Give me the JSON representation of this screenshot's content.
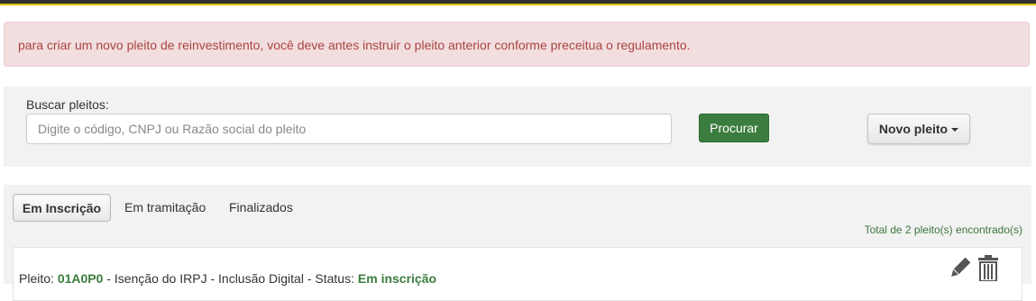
{
  "alert": {
    "message": "para criar um novo pleito de reinvestimento, você deve antes instruir o pleito anterior conforme preceitua o regulamento."
  },
  "search": {
    "label": "Buscar pleitos:",
    "placeholder": "Digite o código, CNPJ ou Razão social do pleito",
    "value": "",
    "button_label": "Procurar",
    "new_button_label": "Novo pleito",
    "colors": {
      "search_button": "#3b7d3e"
    }
  },
  "tabs": [
    {
      "label": "Em Inscrição",
      "active": true
    },
    {
      "label": "Em tramitação",
      "active": false
    },
    {
      "label": "Finalizados",
      "active": false
    }
  ],
  "results": {
    "total_text": "Total de 2 pleito(s) encontrado(s)"
  },
  "pleito": {
    "prefix": "Pleito:",
    "code": "01A0P0",
    "middle": "- Isenção do IRPJ - Inclusão Digital -",
    "status_prefix": "Status:",
    "status": "Em inscrição",
    "icons": [
      "edit-icon",
      "trash-icon"
    ]
  }
}
